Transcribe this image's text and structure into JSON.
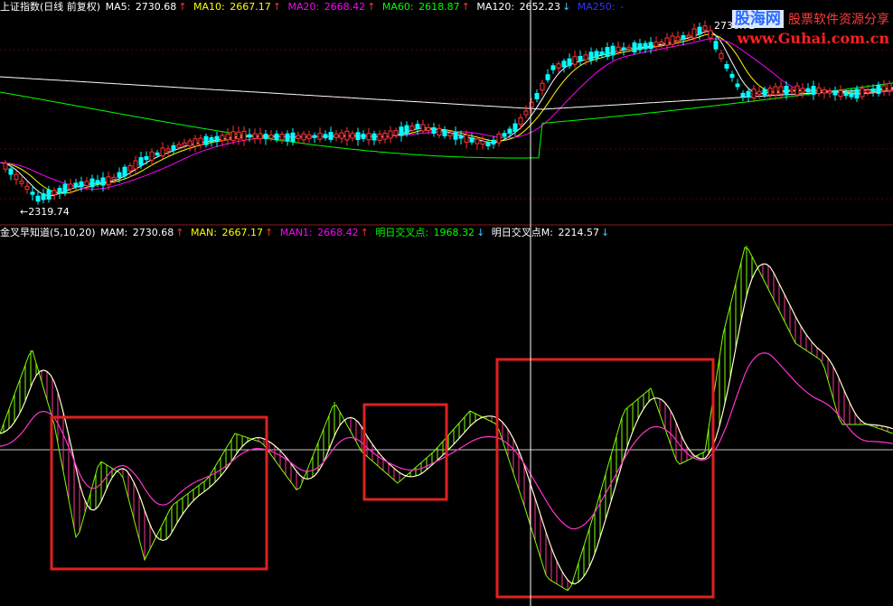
{
  "colors": {
    "background": "#000000",
    "panel_divider": "#8b1a1a",
    "ma5": "#ffffff",
    "ma10": "#ffff00",
    "ma20": "#ff00ff",
    "ma60": "#00ff00",
    "ma120": "#ffffff",
    "ma250": "#3333ff",
    "up_candle": "#ff3333",
    "down_candle": "#00ffff",
    "highlight_box": "#e02020"
  },
  "main_panel": {
    "title": "上证指数(日线 前复权)",
    "indicators": [
      {
        "name": "MA5",
        "value": "2730.68",
        "arrow": "↑",
        "color": "#ffffff"
      },
      {
        "name": "MA10",
        "value": "2667.17",
        "arrow": "↑",
        "color": "#ffff00"
      },
      {
        "name": "MA20",
        "value": "2668.42",
        "arrow": "↑",
        "color": "#ff00ff"
      },
      {
        "name": "MA60",
        "value": "2618.87",
        "arrow": "↑",
        "color": "#00ff00"
      },
      {
        "name": "MA120",
        "value": "2652.23",
        "arrow": "↓",
        "color": "#ffffff"
      },
      {
        "name": "MA250",
        "value": "-",
        "arrow": "",
        "color": "#3333ff"
      }
    ],
    "low_label": "←2319.74",
    "high_label": "2736.72"
  },
  "sub_panel": {
    "title": "金叉早知道(5,10,20)",
    "indicators": [
      {
        "name": "MAM",
        "value": "2730.68",
        "arrow": "↑",
        "color": "#ffffff"
      },
      {
        "name": "MAN",
        "value": "2667.17",
        "arrow": "↑",
        "color": "#ffff00"
      },
      {
        "name": "MAN1",
        "value": "2668.42",
        "arrow": "↑",
        "color": "#ff00ff"
      },
      {
        "name": "明日交叉点",
        "value": "1968.32",
        "arrow": "↓",
        "color": "#00ff00"
      },
      {
        "name": "明日交叉点M",
        "value": "2214.57",
        "arrow": "↓",
        "color": "#ffffff"
      }
    ]
  },
  "watermark": {
    "brand": "股海网",
    "tagline": "股票软件资源分享",
    "url": "www.Guhai.com.cn"
  }
}
